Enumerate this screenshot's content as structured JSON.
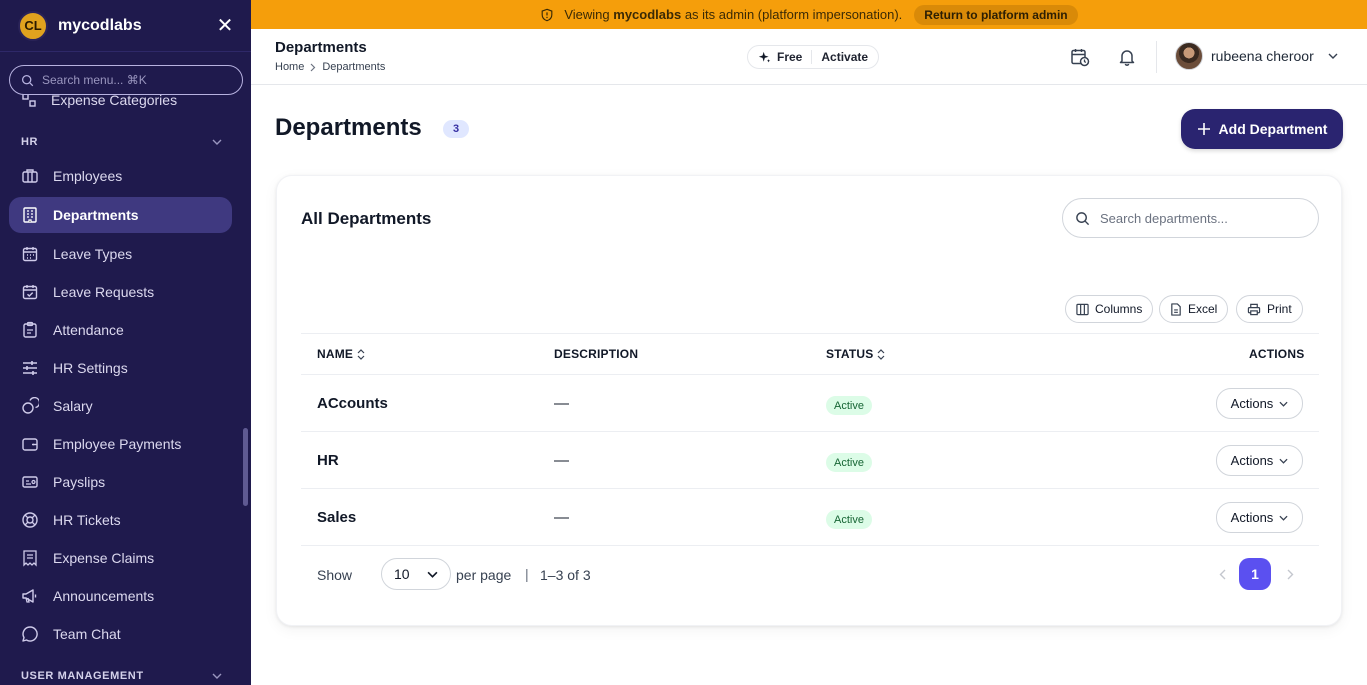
{
  "sidebar": {
    "brand": "mycodlabs",
    "logo_text": "CL",
    "search_placeholder": "Search menu... ⌘K",
    "partial_item": "Expense Categories",
    "hr_section": "HR",
    "user_mgmt_section": "USER MANAGEMENT",
    "items": [
      {
        "label": "Employees",
        "icon": "briefcase-icon"
      },
      {
        "label": "Departments",
        "icon": "building-icon",
        "active": true
      },
      {
        "label": "Leave Types",
        "icon": "calendar-icon"
      },
      {
        "label": "Leave Requests",
        "icon": "calendar-check-icon"
      },
      {
        "label": "Attendance",
        "icon": "clipboard-icon"
      },
      {
        "label": "HR Settings",
        "icon": "sliders-icon"
      },
      {
        "label": "Salary",
        "icon": "coins-icon"
      },
      {
        "label": "Employee Payments",
        "icon": "wallet-icon"
      },
      {
        "label": "Payslips",
        "icon": "payslip-icon"
      },
      {
        "label": "HR Tickets",
        "icon": "lifebuoy-icon"
      },
      {
        "label": "Expense Claims",
        "icon": "receipt-icon"
      },
      {
        "label": "Announcements",
        "icon": "megaphone-icon"
      },
      {
        "label": "Team Chat",
        "icon": "chat-icon"
      }
    ]
  },
  "banner": {
    "prefix": "Viewing",
    "org": "mycodlabs",
    "suffix": "as its admin (platform impersonation).",
    "return_label": "Return to platform admin"
  },
  "header": {
    "title": "Departments",
    "breadcrumb_home": "Home",
    "breadcrumb_current": "Departments",
    "plan": "Free",
    "activate": "Activate",
    "user_name": "rubeena cheroor"
  },
  "main": {
    "title": "Departments",
    "count": "3",
    "add_label": "Add Department"
  },
  "card": {
    "title": "All Departments",
    "search_placeholder": "Search departments...",
    "tools": {
      "columns": "Columns",
      "excel": "Excel",
      "print": "Print"
    },
    "columns": {
      "name": "NAME",
      "description": "DESCRIPTION",
      "status": "STATUS",
      "actions": "ACTIONS"
    },
    "rows": [
      {
        "name": "ACcounts",
        "description": "—",
        "status": "Active",
        "action": "Actions"
      },
      {
        "name": "HR",
        "description": "—",
        "status": "Active",
        "action": "Actions"
      },
      {
        "name": "Sales",
        "description": "—",
        "status": "Active",
        "action": "Actions"
      }
    ],
    "footer": {
      "show": "Show",
      "per_page_value": "10",
      "per_page": "per page",
      "separator": "|",
      "range": "1–3 of 3",
      "current_page": "1"
    }
  },
  "colors": {
    "sidebar_bg": "#1f1a4d",
    "banner_bg": "#f59e0b",
    "primary": "#2a2470",
    "pagination_active": "#5b50f0",
    "status_bg": "#dcfce7",
    "status_text": "#166534"
  }
}
